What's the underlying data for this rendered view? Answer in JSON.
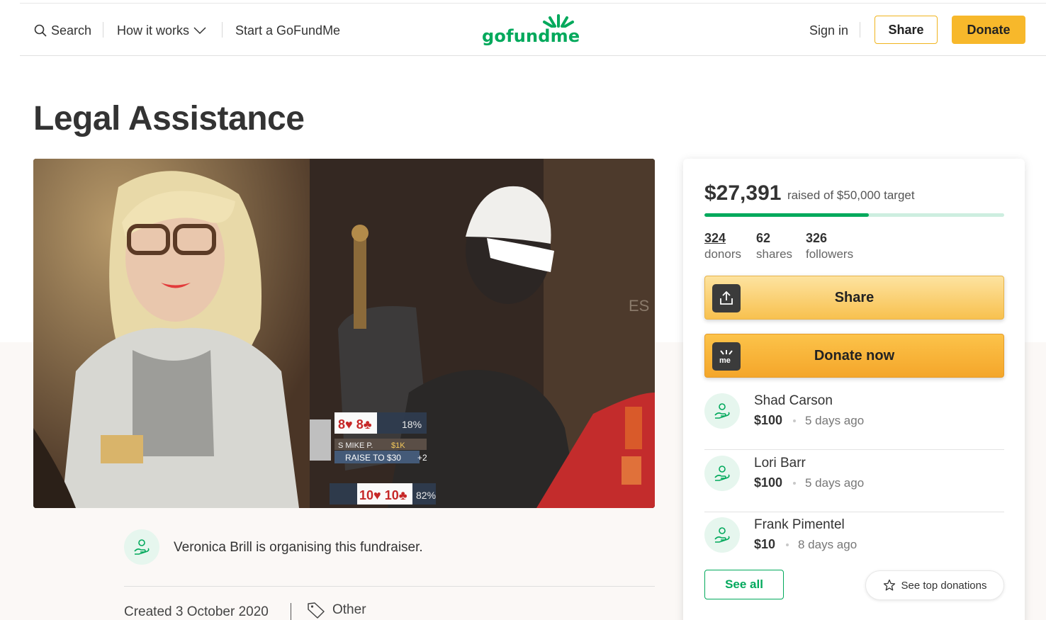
{
  "nav": {
    "search_label": "Search",
    "how_label": "How it works",
    "start_label": "Start a GoFundMe",
    "logo_text": "gofundme",
    "signin_label": "Sign in",
    "share_label": "Share",
    "donate_label": "Donate"
  },
  "campaign": {
    "title": "Legal Assistance",
    "raised": "$27,391",
    "target_text": "raised of $50,000 target",
    "progress_fraction": 0.5478,
    "stats": [
      {
        "num": "324",
        "label": "donors"
      },
      {
        "num": "62",
        "label": "shares"
      },
      {
        "num": "326",
        "label": "followers"
      }
    ],
    "share_button": "Share",
    "donate_button": "Donate now",
    "donations": [
      {
        "name": "Shad Carson",
        "amount": "$100",
        "time": "5 days ago"
      },
      {
        "name": "Lori Barr",
        "amount": "$100",
        "time": "5 days ago"
      },
      {
        "name": "Frank Pimentel",
        "amount": "$10",
        "time": "8 days ago"
      }
    ],
    "see_all": "See all",
    "see_top": "See top donations",
    "organiser_text": "Veronica Brill is organising this fundraiser.",
    "created": "Created 3 October 2020",
    "category": "Other"
  },
  "hero_overlay": {
    "hand1": "8♥ 8♣",
    "pct1": "18%",
    "player": "S MIKE P.",
    "stack": "$1K",
    "action": "RAISE TO $30",
    "plus": "+2",
    "hand2": "10♥ 10♣",
    "pct2": "82%",
    "wall_text": "ES"
  },
  "colors": {
    "brand_green": "#02a95c",
    "donate_yellow": "#f7b82b",
    "text": "#333333"
  }
}
